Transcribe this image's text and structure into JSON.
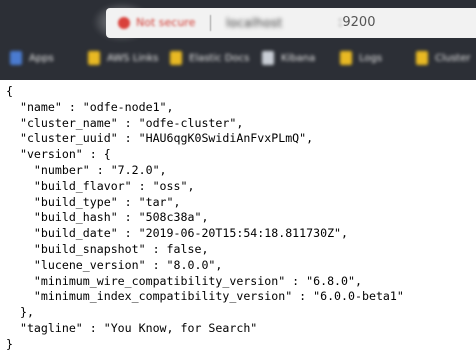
{
  "browser": {
    "security_label": "Not secure",
    "url_host": "localhost",
    "url_port": "9200",
    "bookmarks": [
      "Apps",
      "AWS Links",
      "Elastic Docs",
      "Kibana",
      "Logs",
      "Cluster"
    ]
  },
  "document": {
    "lines": [
      "{",
      "  \"name\" : \"odfe-node1\",",
      "  \"cluster_name\" : \"odfe-cluster\",",
      "  \"cluster_uuid\" : \"HAU6qgK0SwidiAnFvxPLmQ\",",
      "  \"version\" : {",
      "    \"number\" : \"7.2.0\",",
      "    \"build_flavor\" : \"oss\",",
      "    \"build_type\" : \"tar\",",
      "    \"build_hash\" : \"508c38a\",",
      "    \"build_date\" : \"2019-06-20T15:54:18.811730Z\",",
      "    \"build_snapshot\" : false,",
      "    \"lucene_version\" : \"8.0.0\",",
      "    \"minimum_wire_compatibility_version\" : \"6.8.0\",",
      "    \"minimum_index_compatibility_version\" : \"6.0.0-beta1\"",
      "  },",
      "  \"tagline\" : \"You Know, for Search\"",
      "}"
    ]
  },
  "colors": {
    "chrome_background": "#2c2f36",
    "address_bar": "#f2f2f2",
    "security_warning": "#d23b33",
    "page_background": "#ffffff",
    "text": "#000000"
  },
  "icons": [
    "not-secure-warning-icon",
    "folder-icon",
    "apps-grid-icon",
    "page-icon"
  ]
}
